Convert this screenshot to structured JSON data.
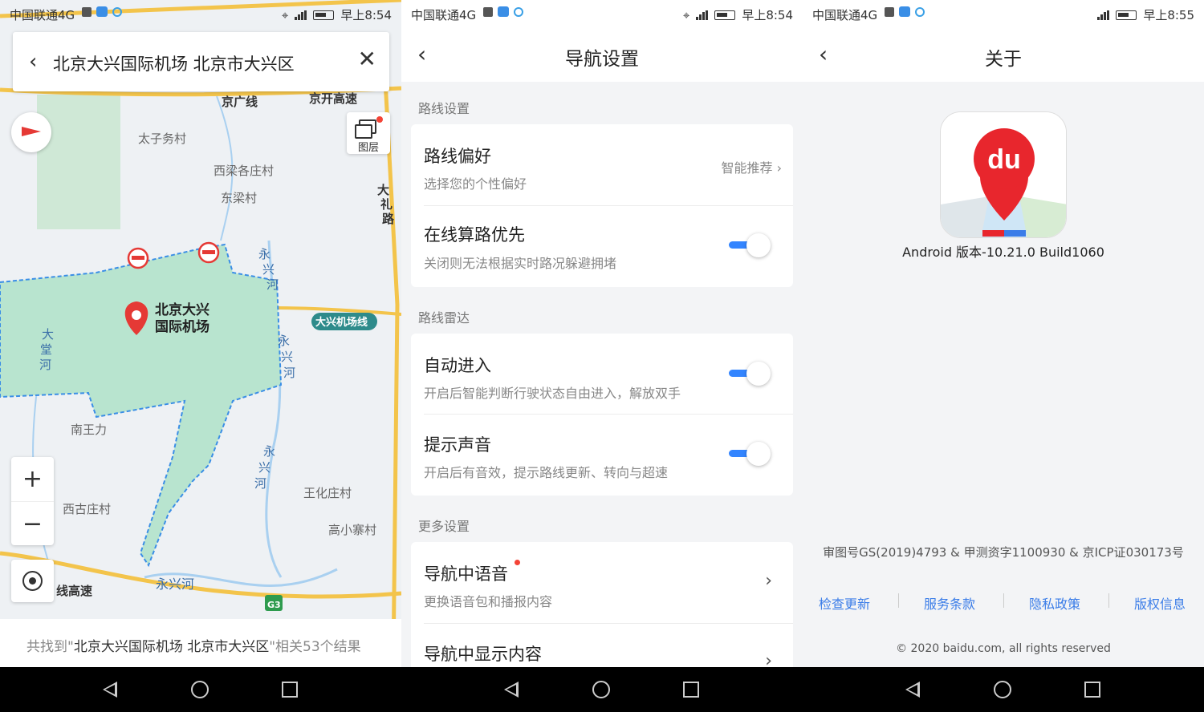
{
  "status": {
    "carrier": "中国联通4G",
    "time_left": "早上8:54",
    "time_mid": "早上8:54",
    "time_right": "早上8:55"
  },
  "map_screen": {
    "search_query": "北京大兴国际机场 北京市大兴区",
    "layer_label": "图层",
    "result_prefix": "共找到\"",
    "result_query": "北京大兴国际机场 北京市大兴区",
    "result_suffix": "\"相关53个结果",
    "zoom_in": "+",
    "zoom_out": "−",
    "place_labels": {
      "jingguang": "京广线",
      "jingkai": "京开高速",
      "taizi": "太子务村",
      "xiliang": "西梁各庄村",
      "dongliang": "东梁村",
      "dali_1": "大",
      "dali_2": "礼",
      "dali_3": "路",
      "yongxing_top_1": "永",
      "yongxing_top_2": "兴",
      "yongxing_top_3": "河",
      "airport_1": "北京大兴",
      "airport_2": "国际机场",
      "daxing_line": "大兴机场线",
      "datang_1": "大",
      "datang_2": "堂",
      "datang_3": "河",
      "yongxing_mid_1": "永",
      "yongxing_mid_2": "兴",
      "yongxing_mid_3": "河",
      "nanwangli": "南王力",
      "yongxing_low_1": "永",
      "yongxing_low_2": "兴",
      "yongxing_low_3": "河",
      "wanghua": "王化庄村",
      "xigu": "西古庄村",
      "gaoxiaozhai": "高小寨村",
      "yongxing_bottom": "永兴河",
      "highway_bottom": "线高速",
      "g3": "G3"
    }
  },
  "nav_settings": {
    "title": "导航设置",
    "sections": {
      "route": "路线设置",
      "radar": "路线雷达",
      "more": "更多设置"
    },
    "route_pref": {
      "title": "路线偏好",
      "subtitle": "选择您的个性偏好",
      "value": "智能推荐"
    },
    "online_calc": {
      "title": "在线算路优先",
      "subtitle": "关闭则无法根据实时路况躲避拥堵",
      "on": true
    },
    "auto_enter": {
      "title": "自动进入",
      "subtitle": "开启后智能判断行驶状态自由进入，解放双手",
      "on": true
    },
    "sound": {
      "title": "提示声音",
      "subtitle": "开启后有音效，提示路线更新、转向与超速",
      "on": true
    },
    "voice": {
      "title": "导航中语音",
      "subtitle": "更换语音包和播报内容"
    },
    "display": {
      "title": "导航中显示内容"
    }
  },
  "about": {
    "title": "关于",
    "app_logo_text": "du",
    "version": "Android 版本-10.21.0 Build1060",
    "license": "审图号GS(2019)4793 & 甲测资字1100930 & 京ICP证030173号",
    "links": [
      "检查更新",
      "服务条款",
      "隐私政策",
      "版权信息"
    ],
    "copyright": "© 2020 baidu.com, all rights reserved"
  },
  "colors": {
    "accent_blue": "#3385ff",
    "link_blue": "#3b7de8",
    "pin_red": "#e53935",
    "airport_fill": "#b8e4cf",
    "road_yellow": "#f3c44b"
  },
  "icons": [
    "back-arrow-icon",
    "close-icon",
    "compass-icon",
    "layers-icon",
    "locate-icon",
    "chevron-right-icon",
    "location-pin-icon",
    "no-entry-icon",
    "nav-back-icon",
    "nav-home-icon",
    "nav-recents-icon"
  ]
}
